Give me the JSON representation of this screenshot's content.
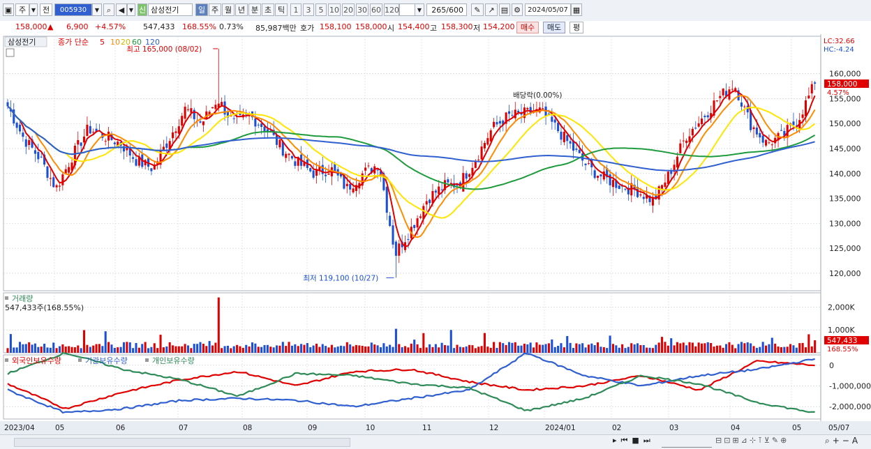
{
  "toolbar": {
    "type_label": "주",
    "market_label": "전",
    "code": "005930",
    "name_badge": "신",
    "stock_name": "삼성전기",
    "period_tabs": [
      "일",
      "주",
      "월",
      "년",
      "분",
      "초",
      "틱"
    ],
    "active_period": "일",
    "interval_buttons": [
      "1",
      "3",
      "5",
      "10",
      "20",
      "30",
      "60",
      "120"
    ],
    "count": "265",
    "count_total": "/600",
    "date": "2024/05/07"
  },
  "infobar": {
    "price": "158,000",
    "arrow": "▲",
    "change": "6,900",
    "change_pct": "+4.57%",
    "volume": "547,433",
    "volume_ratio": "168.55%",
    "turnover": "0.73%",
    "amount": "85,987백만",
    "quote_label": "호가",
    "ask": "158,100",
    "bid": "158,000",
    "open_label": "시",
    "open": "154,400",
    "high_label": "고",
    "high": "158,300",
    "low_label": "저",
    "low": "154,200",
    "buy_button": "매수",
    "sell_button": "매도",
    "eval_button": "평"
  },
  "price_panel": {
    "title": "삼성전기",
    "legend_prefix": "종가 단순",
    "ma_labels": [
      "5",
      "10",
      "20",
      "60",
      "120"
    ],
    "ma_colors": [
      "#e00000",
      "#ff8c00",
      "#ffe600",
      "#1e9b3c",
      "#2f5fd0"
    ],
    "lc": "LC:32.66",
    "hc": "HC:-4.24",
    "high_annotation": "최고 165,000 (08/02)",
    "low_annotation": "최저 119,100 (10/27)",
    "dividend_annotation": "배당락(0.00%)",
    "current_price_tag": "158,000",
    "current_pct_tag": "4.57%"
  },
  "volume_panel": {
    "title": "거래량",
    "value_label": "547,433주(168.55%)",
    "tag_value": "547,433",
    "tag_pct": "168.55%",
    "axis_labels": [
      "2,000K",
      "1,000K"
    ]
  },
  "holding_panel": {
    "legend": [
      "외국인보유수량",
      "기관보유수량",
      "개인보유수량"
    ],
    "colors": [
      "#e00000",
      "#2f5fd0",
      "#2e8b57"
    ],
    "axis_labels": [
      "0",
      "-1,000,000",
      "-2,000,000"
    ]
  },
  "x_axis": {
    "labels": [
      "2023/04",
      "05",
      "06",
      "07",
      "08",
      "09",
      "10",
      "11",
      "12",
      "2024/01",
      "02",
      "03",
      "04",
      "05",
      "05/07"
    ]
  },
  "chart_data": {
    "type": "candlestick",
    "title": "삼성전기",
    "y_ticks": [
      160000,
      155000,
      150000,
      145000,
      140000,
      135000,
      130000,
      125000,
      120000
    ],
    "ylim": [
      116500,
      167500
    ],
    "highlights": {
      "high": {
        "value": 165000,
        "date": "08/02"
      },
      "low": {
        "value": 119100,
        "date": "10/27"
      }
    },
    "close_anchors": [
      [
        "2023/04",
        153500
      ],
      [
        "04/24",
        147000
      ],
      [
        "05/01",
        143000
      ],
      [
        "05/12",
        137000
      ],
      [
        "05/22",
        143500
      ],
      [
        "06/01",
        149000
      ],
      [
        "06/12",
        147500
      ],
      [
        "06/22",
        146000
      ],
      [
        "07/03",
        142500
      ],
      [
        "07/10",
        141000
      ],
      [
        "07/19",
        147000
      ],
      [
        "07/24",
        153000
      ],
      [
        "07/31",
        150000
      ],
      [
        "08/02",
        155000
      ],
      [
        "08/08",
        150000
      ],
      [
        "08/18",
        151500
      ],
      [
        "08/28",
        149000
      ],
      [
        "09/05",
        145000
      ],
      [
        "09/13",
        142000
      ],
      [
        "09/22",
        140000
      ],
      [
        "10/04",
        141000
      ],
      [
        "10/12",
        137000
      ],
      [
        "10/20",
        140000
      ],
      [
        "10/25",
        142000
      ],
      [
        "10/27",
        124000
      ],
      [
        "11/02",
        129000
      ],
      [
        "11/10",
        135000
      ],
      [
        "11/20",
        137500
      ],
      [
        "11/28",
        138000
      ],
      [
        "12/05",
        143000
      ],
      [
        "12/12",
        149000
      ],
      [
        "12/20",
        151500
      ],
      [
        "12/28",
        152000
      ],
      [
        "2024/01/05",
        152500
      ],
      [
        "01/10",
        149000
      ],
      [
        "01/19",
        145000
      ],
      [
        "01/29",
        141000
      ],
      [
        "02/05",
        139000
      ],
      [
        "02/15",
        137500
      ],
      [
        "02/26",
        136500
      ],
      [
        "03/05",
        134500
      ],
      [
        "03/12",
        140000
      ],
      [
        "03/19",
        147500
      ],
      [
        "03/28",
        151000
      ],
      [
        "04/05",
        155000
      ],
      [
        "04/12",
        158000
      ],
      [
        "04/19",
        150000
      ],
      [
        "04/24",
        146000
      ],
      [
        "04/29",
        147500
      ],
      [
        "05/03",
        151100
      ],
      [
        "05/07",
        158000
      ]
    ],
    "volume": {
      "last_value": 547433,
      "axis_max": 2500000,
      "axis_ticks": [
        2000000,
        1000000
      ]
    },
    "holding_series": [
      {
        "name": "외국인보유수량",
        "color": "#e00000",
        "values": [
          -900000,
          -2100000,
          -1300000,
          -700000,
          -300000,
          -1000000,
          -300000,
          -200000,
          -800000,
          -1200000,
          -1000000,
          -500000,
          -1200000,
          200000,
          0
        ]
      },
      {
        "name": "기관보유수량",
        "color": "#2f5fd0",
        "values": [
          -1200000,
          -2300000,
          -2100000,
          -1700000,
          -1600000,
          -1700000,
          -2000000,
          -1600000,
          -1200000,
          600000,
          -500000,
          -1000000,
          -500000,
          -200000,
          300000
        ]
      },
      {
        "name": "개인보유수량",
        "color": "#2e8b57",
        "values": [
          -400000,
          600000,
          -200000,
          -700000,
          -1500000,
          -400000,
          -500000,
          -900000,
          -1100000,
          -2200000,
          -1600000,
          -500000,
          -900000,
          -1800000,
          -2300000
        ]
      }
    ],
    "holding_ticks": [
      0,
      -1000000,
      -2000000
    ]
  }
}
